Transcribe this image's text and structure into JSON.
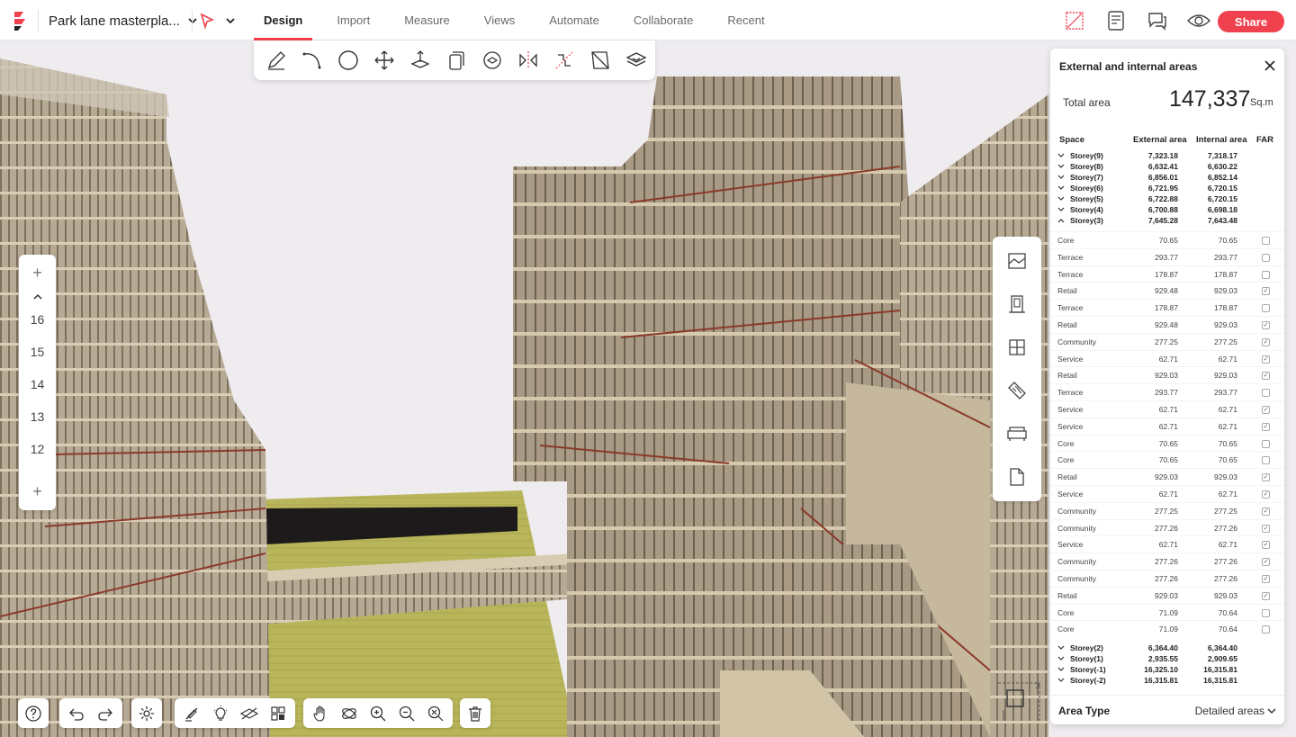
{
  "app": {
    "project_name": "Park lane masterpla...",
    "tabs": [
      "Design",
      "Import",
      "Measure",
      "Views",
      "Automate",
      "Collaborate",
      "Recent"
    ],
    "active_tab": "Design",
    "share_label": "Share",
    "accent": "#f0414e"
  },
  "toolbar": {
    "tools": [
      "pencil-icon",
      "arc-icon",
      "circle-icon",
      "move-icon",
      "push-pull-icon",
      "offset-icon",
      "rotate-icon",
      "mirror-icon",
      "split-icon",
      "face-icon",
      "section-icon"
    ]
  },
  "floor_selector": {
    "add_top": "+",
    "levels": [
      "16",
      "15",
      "14",
      "13",
      "12"
    ],
    "add_bottom": "+"
  },
  "panel": {
    "title": "External and internal areas",
    "total_label": "Total area",
    "total_value": "147,337",
    "total_unit": "Sq.m",
    "headers": {
      "space": "Space",
      "external": "External area",
      "internal": "Internal area",
      "far": "FAR"
    },
    "storeys_top": [
      {
        "name": "Storey(9)",
        "external": "7,323.18",
        "internal": "7,318.17"
      },
      {
        "name": "Storey(8)",
        "external": "6,632.41",
        "internal": "6,630.22"
      },
      {
        "name": "Storey(7)",
        "external": "6,856.01",
        "internal": "6,852.14"
      },
      {
        "name": "Storey(6)",
        "external": "6,721.95",
        "internal": "6,720.15"
      },
      {
        "name": "Storey(5)",
        "external": "6,722.88",
        "internal": "6,720.15"
      },
      {
        "name": "Storey(4)",
        "external": "6,700.88",
        "internal": "6,698.18"
      },
      {
        "name": "Storey(3)",
        "external": "7,645.28",
        "internal": "7,643.48"
      }
    ],
    "spaces": [
      {
        "name": "Core",
        "external": "70.65",
        "internal": "70.65",
        "far": false
      },
      {
        "name": "Terrace",
        "external": "293.77",
        "internal": "293.77",
        "far": false
      },
      {
        "name": "Terrace",
        "external": "178.87",
        "internal": "178.87",
        "far": false
      },
      {
        "name": "Retail",
        "external": "929.48",
        "internal": "929.03",
        "far": true
      },
      {
        "name": "Terrace",
        "external": "178.87",
        "internal": "178.87",
        "far": false
      },
      {
        "name": "Retail",
        "external": "929.48",
        "internal": "929.03",
        "far": true
      },
      {
        "name": "Community",
        "external": "277.25",
        "internal": "277.25",
        "far": true
      },
      {
        "name": "Service",
        "external": "62.71",
        "internal": "62.71",
        "far": true
      },
      {
        "name": "Retail",
        "external": "929.03",
        "internal": "929.03",
        "far": true
      },
      {
        "name": "Terrace",
        "external": "293.77",
        "internal": "293.77",
        "far": false
      },
      {
        "name": "Service",
        "external": "62.71",
        "internal": "62.71",
        "far": true
      },
      {
        "name": "Service",
        "external": "62.71",
        "internal": "62.71",
        "far": true
      },
      {
        "name": "Core",
        "external": "70.65",
        "internal": "70.65",
        "far": false
      },
      {
        "name": "Core",
        "external": "70.65",
        "internal": "70.65",
        "far": false
      },
      {
        "name": "Retail",
        "external": "929.03",
        "internal": "929.03",
        "far": true
      },
      {
        "name": "Service",
        "external": "62.71",
        "internal": "62.71",
        "far": true
      },
      {
        "name": "Community",
        "external": "277.25",
        "internal": "277.25",
        "far": true
      },
      {
        "name": "Community",
        "external": "277.26",
        "internal": "277.26",
        "far": true
      },
      {
        "name": "Service",
        "external": "62.71",
        "internal": "62.71",
        "far": true
      },
      {
        "name": "Community",
        "external": "277.26",
        "internal": "277.26",
        "far": true
      },
      {
        "name": "Community",
        "external": "277.26",
        "internal": "277.26",
        "far": true
      },
      {
        "name": "Retail",
        "external": "929.03",
        "internal": "929.03",
        "far": true
      },
      {
        "name": "Core",
        "external": "71.09",
        "internal": "70.64",
        "far": false
      },
      {
        "name": "Core",
        "external": "71.09",
        "internal": "70.64",
        "far": false
      }
    ],
    "storeys_bottom": [
      {
        "name": "Storey(2)",
        "external": "6,364.40",
        "internal": "6,364.40"
      },
      {
        "name": "Storey(1)",
        "external": "2,935.55",
        "internal": "2,909.65"
      },
      {
        "name": "Storey(-1)",
        "external": "16,325.10",
        "internal": "16,315.81"
      },
      {
        "name": "Storey(-2)",
        "external": "16,315.81",
        "internal": "16,315.81"
      }
    ],
    "area_type_label": "Area Type",
    "area_type_value": "Detailed areas"
  }
}
